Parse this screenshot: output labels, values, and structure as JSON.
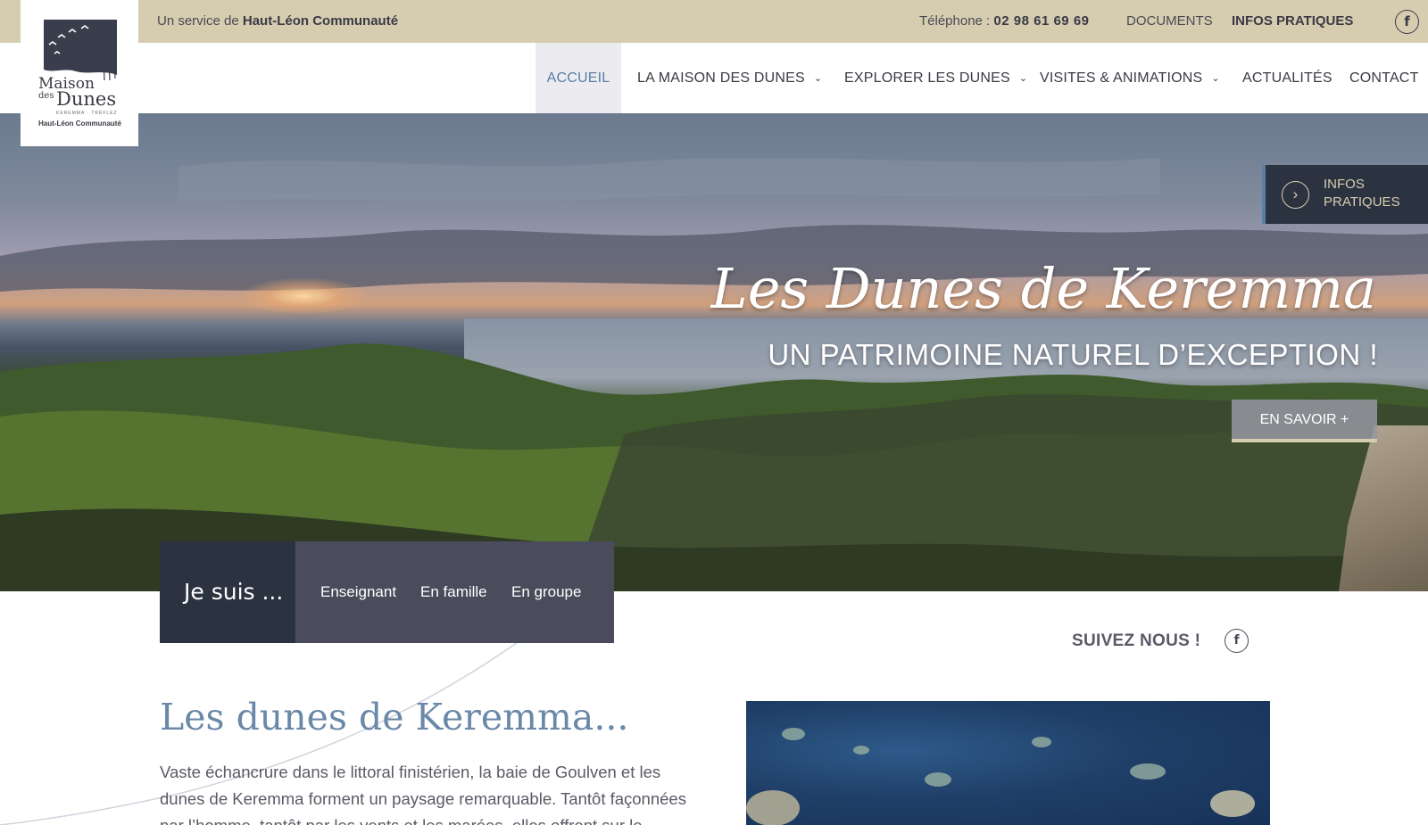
{
  "topbar": {
    "service_prefix": "Un service de ",
    "service_org": "Haut-Léon Communauté",
    "phone_label": "Téléphone : ",
    "phone_number": "02 98 61 69 69",
    "documents": "DOCUMENTS",
    "infos_pratiques": "INFOS PRATIQUES",
    "facebook_glyph": "f"
  },
  "logo": {
    "line1": "Maison",
    "line2": "des",
    "line3": "Dunes",
    "sub": "KEREMMA · TRÉFLEZ",
    "org": "Haut-Léon Communauté"
  },
  "nav": {
    "items": [
      {
        "label": "ACCUEIL",
        "active": true,
        "dropdown": false
      },
      {
        "label": "LA MAISON DES DUNES",
        "active": false,
        "dropdown": true
      },
      {
        "label": "EXPLORER LES DUNES",
        "active": false,
        "dropdown": true
      },
      {
        "label": "VISITES & ANIMATIONS",
        "active": false,
        "dropdown": true
      },
      {
        "label": "ACTUALITÉS",
        "active": false,
        "dropdown": false
      },
      {
        "label": "CONTACT",
        "active": false,
        "dropdown": false
      }
    ],
    "chevron_glyph": "⌄"
  },
  "hero": {
    "title": "Les Dunes de Keremma",
    "subtitle": "UN PATRIMOINE NATUREL D’EXCEPTION !",
    "cta": "EN SAVOIR +"
  },
  "infos_box": {
    "line1": "INFOS",
    "line2": "PRATIQUES",
    "arrow_glyph": "›"
  },
  "jesuis": {
    "head": "Je suis ...",
    "options": [
      "Enseignant",
      "En famille",
      "En groupe"
    ]
  },
  "follow": {
    "label": "SUIVEZ NOUS !",
    "facebook_glyph": "f"
  },
  "intro": {
    "heading": "Les dunes de Keremma...",
    "paragraph": "Vaste échancrure dans le littoral finistérien, la baie de Goulven et les dunes de Keremma forment un paysage remarquable. Tantôt façonnées par l’homme, tantôt par les vents et les marées, elles offrent sur le"
  },
  "colors": {
    "topbar": "#d6cdb1",
    "accent_blue": "#5a7fa6",
    "dark_panel": "#2c3340",
    "option_panel": "#4a4c5c"
  }
}
